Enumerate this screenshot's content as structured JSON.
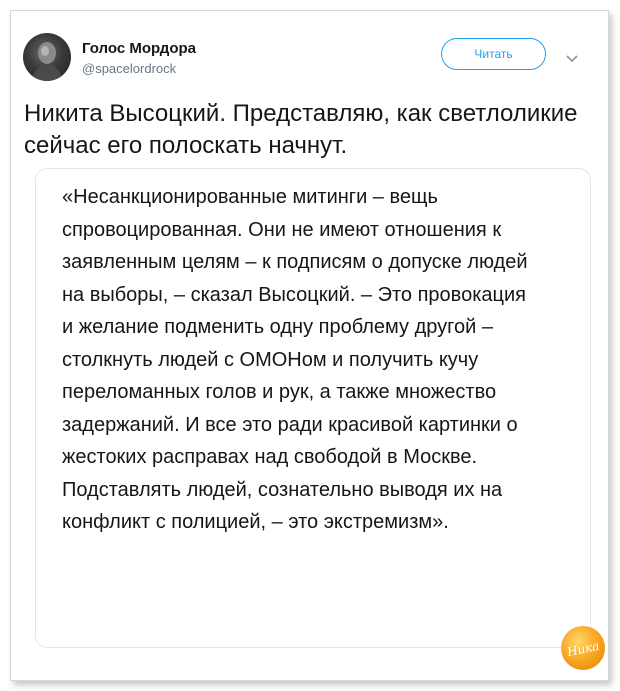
{
  "tweet": {
    "author_name": "Голос Мордора",
    "author_handle": "@spacelordrock",
    "follow_label": "Читать",
    "text": "Никита Высоцкий. Представляю, как светлоликие сейчас его полоскать начнут.",
    "quote": "«Несанкционированные митинги – вещь спровоцированная. Они не имеют отношения к заявленным целям – к подписям о допуске людей на выборы, – сказал Высоцкий. – Это провокация и желание подменить одну проблему другой – столкнуть людей с ОМОНом и получить кучу переломанных голов и рук, а также множество задержаний. И все это ради красивой картинки о жестоких расправах над свободой в Москве. Подставлять людей, сознательно выводя их на конфликт с полицией, – это экстремизм»."
  },
  "watermark": {
    "text": "Ника",
    "color": "#f6a11c"
  },
  "colors": {
    "accent": "#1da1f2",
    "text": "#14171a",
    "secondary": "#657786",
    "border": "#e1e8ed"
  }
}
